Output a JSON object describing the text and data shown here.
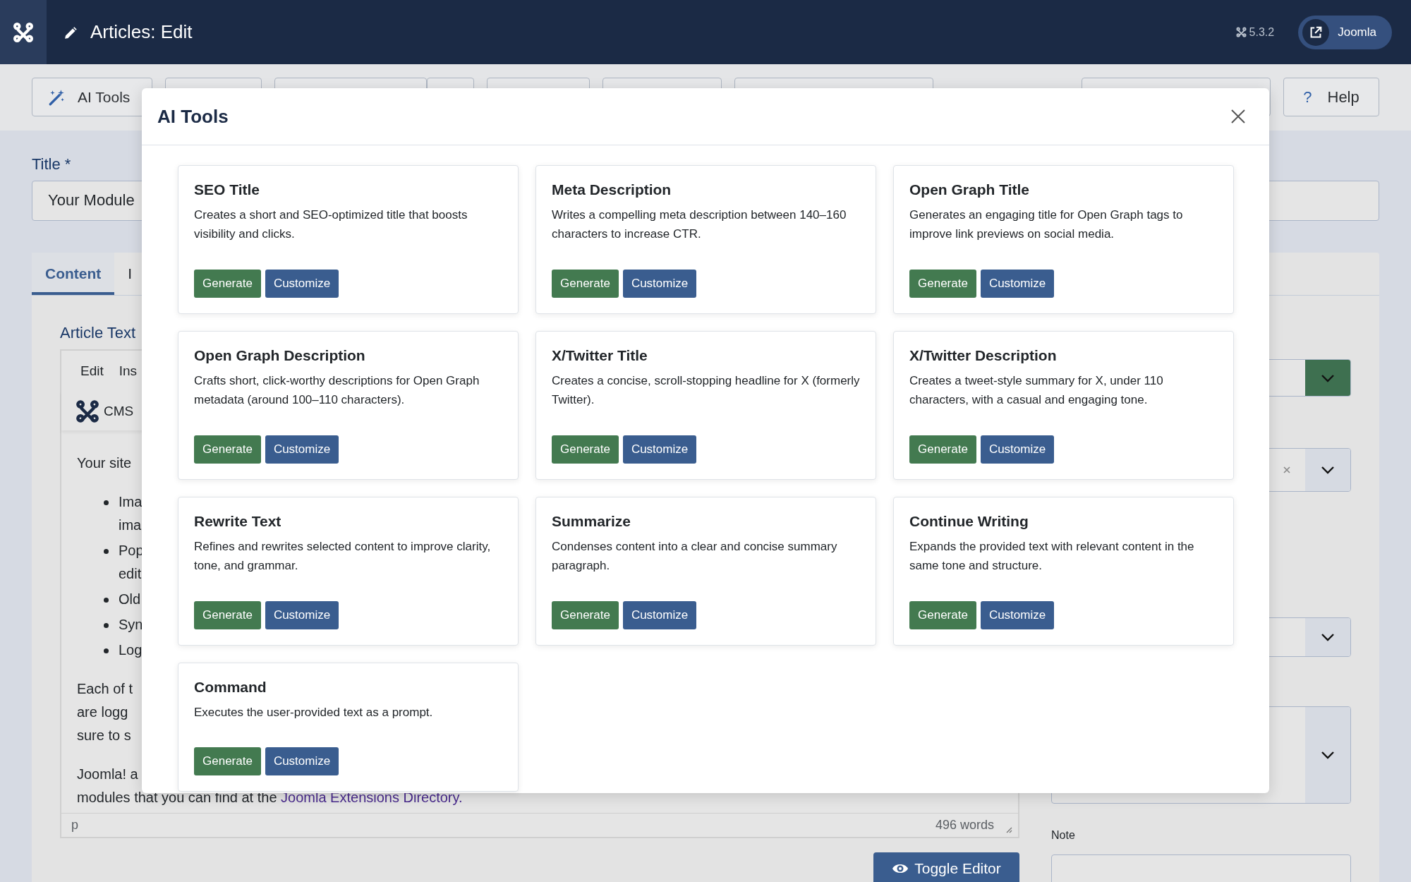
{
  "header": {
    "title": "Articles: Edit",
    "version": "5.3.2",
    "site_button": "Joomla"
  },
  "toolbar": {
    "ai_button": "AI Tools",
    "help_glyph": "?",
    "help_button": "Help"
  },
  "title_field": {
    "label": "Title *",
    "value": "Your Module"
  },
  "tabs": [
    {
      "label": "Content",
      "selected": true
    },
    {
      "label": "I",
      "selected": false
    }
  ],
  "editor": {
    "label": "Article Text",
    "menu": [
      "Edit",
      "Ins"
    ],
    "toolbar_text": "CMS",
    "content": [
      {
        "kind": "paragraph",
        "lines": [
          "Your site"
        ]
      },
      {
        "kind": "list",
        "items": [
          [
            "Ima",
            "ima"
          ],
          [
            "Pop",
            "edit"
          ],
          [
            "Old"
          ],
          [
            "Syn"
          ],
          [
            "Log"
          ]
        ]
      },
      {
        "kind": "paragraph",
        "lines": [
          "Each of t",
          "are logg",
          "sure to s"
        ]
      },
      {
        "kind": "paragraph",
        "lines": [
          "Joomla! a",
          "modules that you can find at the "
        ],
        "link": "Joomla Extensions Directory."
      }
    ],
    "status_path": "p",
    "word_count": "496 words"
  },
  "toggle_button": "Toggle Editor",
  "note": {
    "label": "Note"
  },
  "modal": {
    "title": "AI Tools",
    "tools": [
      {
        "title": "SEO Title",
        "description": "Creates a short and SEO-optimized title that boosts visibility and clicks.",
        "actions": [
          {
            "label": "Generate",
            "kind": "generate"
          },
          {
            "label": "Customize",
            "kind": "customize"
          }
        ]
      },
      {
        "title": "Meta Description",
        "description": "Writes a compelling meta description between 140–160 characters to increase CTR.",
        "actions": [
          {
            "label": "Generate",
            "kind": "generate"
          },
          {
            "label": "Customize",
            "kind": "customize"
          }
        ]
      },
      {
        "title": "Open Graph Title",
        "description": "Generates an engaging title for Open Graph tags to improve link previews on social media.",
        "actions": [
          {
            "label": "Generate",
            "kind": "generate"
          },
          {
            "label": "Customize",
            "kind": "customize"
          }
        ]
      },
      {
        "title": "Open Graph Description",
        "description": "Crafts short, click-worthy descriptions for Open Graph metadata (around 100–110 characters).",
        "actions": [
          {
            "label": "Generate",
            "kind": "generate"
          },
          {
            "label": "Customize",
            "kind": "customize"
          }
        ]
      },
      {
        "title": "X/Twitter Title",
        "description": "Creates a concise, scroll-stopping headline for X (formerly Twitter).",
        "actions": [
          {
            "label": "Generate",
            "kind": "generate"
          },
          {
            "label": "Customize",
            "kind": "customize"
          }
        ]
      },
      {
        "title": "X/Twitter Description",
        "description": "Creates a tweet-style summary for X, under 110 characters, with a casual and engaging tone.",
        "actions": [
          {
            "label": "Generate",
            "kind": "generate"
          },
          {
            "label": "Customize",
            "kind": "customize"
          }
        ]
      },
      {
        "title": "Rewrite Text",
        "description": "Refines and rewrites selected content to improve clarity, tone, and grammar.",
        "actions": [
          {
            "label": "Generate",
            "kind": "generate"
          },
          {
            "label": "Customize",
            "kind": "customize"
          }
        ]
      },
      {
        "title": "Summarize",
        "description": "Condenses content into a clear and concise summary paragraph.",
        "actions": [
          {
            "label": "Generate",
            "kind": "generate"
          },
          {
            "label": "Customize",
            "kind": "customize"
          }
        ]
      },
      {
        "title": "Continue Writing",
        "description": "Expands the provided text with relevant content in the same tone and structure.",
        "actions": [
          {
            "label": "Generate",
            "kind": "generate"
          },
          {
            "label": "Customize",
            "kind": "customize"
          }
        ]
      },
      {
        "title": "Command",
        "description": "Executes the user-provided text as a prompt.",
        "actions": [
          {
            "label": "Generate",
            "kind": "generate"
          },
          {
            "label": "Customize",
            "kind": "customize"
          }
        ]
      }
    ]
  }
}
